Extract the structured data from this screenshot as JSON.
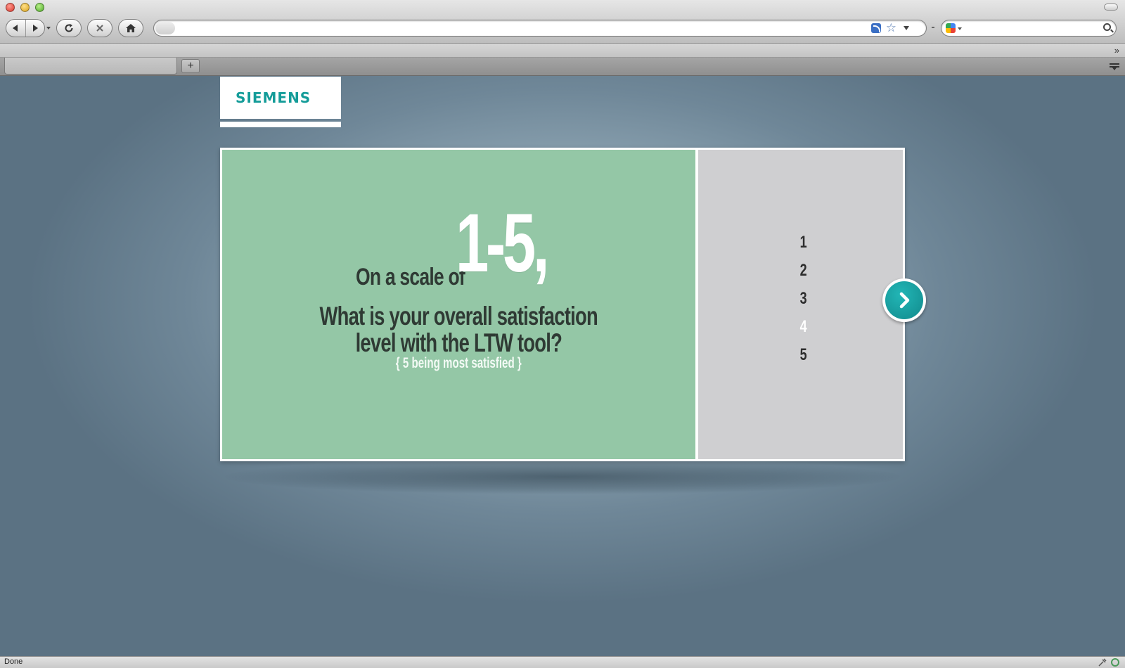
{
  "browser": {
    "url_value": "",
    "search_value": "",
    "tab_label": "",
    "new_tab_label": "+",
    "bookmarks_chevron": "»",
    "status_text": "Done"
  },
  "page": {
    "logo": "SIEMENS",
    "question": {
      "prefix": "On a scale of",
      "range": "1-5,",
      "line1": "What is your overall satisfaction",
      "line2": "level with the LTW tool?",
      "note": "{ 5 being most satisfied }"
    },
    "options": [
      "1",
      "2",
      "3",
      "4",
      "5"
    ],
    "highlighted_option": "4"
  },
  "colors": {
    "brand_teal": "#149c99",
    "question_panel": "#94c7a6",
    "answer_panel": "#cfcfd1",
    "next_button": "#1a9fa0"
  },
  "icons": {
    "back": "back-arrow-icon",
    "forward": "forward-arrow-icon",
    "reload": "reload-icon",
    "stop": "stop-icon",
    "home": "home-icon",
    "rss": "rss-feed-icon",
    "bookmark": "star-icon",
    "search_engine": "google-icon",
    "search": "magnifier-icon",
    "next": "chevron-right-icon"
  }
}
